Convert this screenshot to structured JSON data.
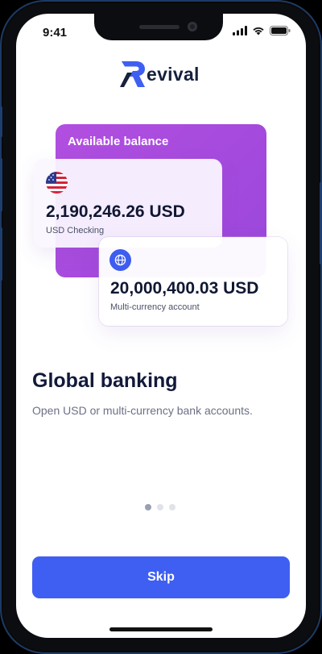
{
  "status_bar": {
    "time": "9:41"
  },
  "brand": {
    "name": "evival",
    "accent_color": "#3e5ff2",
    "text_color": "#16213e"
  },
  "cards": {
    "balance_label": "Available balance",
    "usd": {
      "flag_icon": "us-flag-icon",
      "amount": "2,190,246.26 USD",
      "subtitle": "USD Checking"
    },
    "multi": {
      "icon": "globe-icon",
      "amount": "20,000,400.03 USD",
      "subtitle": "Multi-currency account"
    }
  },
  "onboarding": {
    "title": "Global banking",
    "description": "Open USD or multi-currency bank accounts.",
    "page_count": 3,
    "active_page": 1
  },
  "actions": {
    "skip_label": "Skip"
  },
  "colors": {
    "purple_card": "#a94cdd",
    "button": "#3e5ff2"
  }
}
